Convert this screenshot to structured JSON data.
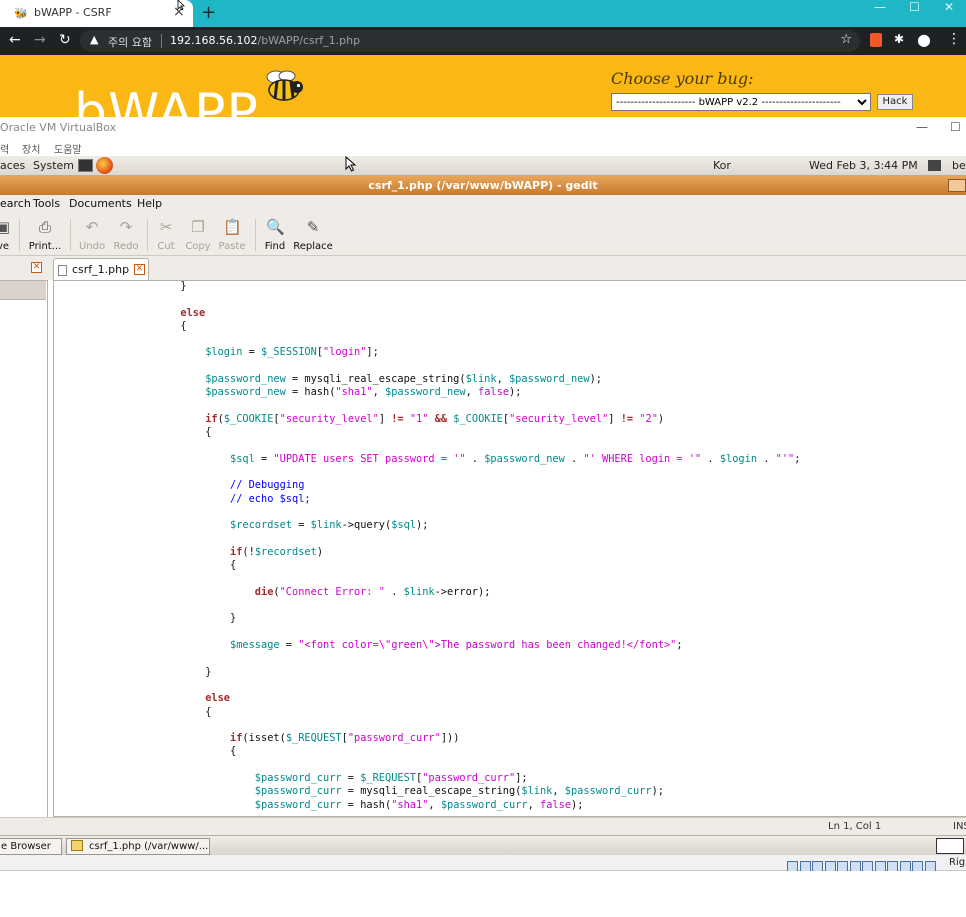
{
  "browser": {
    "tab_title": "bWAPP - CSRF",
    "tab_close": "×",
    "new_tab": "+",
    "warning_text": "주의 요함",
    "url_host": "192.168.56.102",
    "url_path": "/bWAPP/csrf_1.php"
  },
  "bwapp": {
    "logo_text": "bWAPP",
    "choose_label": "Choose your bug:",
    "selected_bug": "---------------------- bWAPP v2.2 ----------------------",
    "hack_label": "Hack"
  },
  "vbox": {
    "title": "Oracle VM VirtualBox",
    "menu": [
      "력",
      "장치",
      "도움말"
    ]
  },
  "gnome_panel": {
    "places": "aces",
    "system": "System",
    "keyboard": "Kor",
    "datetime": "Wed Feb  3,  3:44 PM",
    "user": "bee"
  },
  "gedit": {
    "title": "csrf_1.php (/var/www/bWAPP) - gedit",
    "menu": [
      "earch",
      "Tools",
      "Documents",
      "Help"
    ],
    "toolbar": {
      "save": "ve",
      "print": "Print...",
      "undo": "Undo",
      "redo": "Redo",
      "cut": "Cut",
      "copy": "Copy",
      "paste": "Paste",
      "find": "Find",
      "replace": "Replace"
    },
    "doc_tab": "csrf_1.php",
    "status_position": "Ln 1, Col 1",
    "status_mode": "INS"
  },
  "taskbar": {
    "item1": "e Browser",
    "item2": "csrf_1.php (/var/www/..."
  },
  "vbox_status": {
    "host_key": "Righ"
  },
  "code_lines": [
    [
      [
        "op",
        "            }"
      ]
    ],
    [
      [
        "op",
        ""
      ]
    ],
    [
      [
        "op",
        "            "
      ],
      [
        "kw",
        "else"
      ]
    ],
    [
      [
        "op",
        "            {"
      ]
    ],
    [
      [
        "op",
        ""
      ]
    ],
    [
      [
        "op",
        "                "
      ],
      [
        "vr",
        "$login"
      ],
      [
        "op",
        " = "
      ],
      [
        "vr",
        "$_SESSION"
      ],
      [
        "op",
        "["
      ],
      [
        "st",
        "\"login\""
      ],
      [
        "op",
        "];"
      ]
    ],
    [
      [
        "op",
        ""
      ]
    ],
    [
      [
        "op",
        "                "
      ],
      [
        "vr",
        "$password_new"
      ],
      [
        "op",
        " = mysqli_real_escape_string("
      ],
      [
        "vr",
        "$link"
      ],
      [
        "op",
        ", "
      ],
      [
        "vr",
        "$password_new"
      ],
      [
        "op",
        ");"
      ]
    ],
    [
      [
        "op",
        "                "
      ],
      [
        "vr",
        "$password_new"
      ],
      [
        "op",
        " = hash("
      ],
      [
        "st",
        "\"sha1\""
      ],
      [
        "op",
        ", "
      ],
      [
        "vr",
        "$password_new"
      ],
      [
        "op",
        ", "
      ],
      [
        "st",
        "false"
      ],
      [
        "op",
        ");"
      ]
    ],
    [
      [
        "op",
        ""
      ]
    ],
    [
      [
        "op",
        "                "
      ],
      [
        "kw",
        "if"
      ],
      [
        "op",
        "("
      ],
      [
        "vr",
        "$_COOKIE"
      ],
      [
        "op",
        "["
      ],
      [
        "st",
        "\"security_level\""
      ],
      [
        "op",
        "] "
      ],
      [
        "kw",
        "!="
      ],
      [
        "op",
        " "
      ],
      [
        "st",
        "\"1\""
      ],
      [
        "op",
        " "
      ],
      [
        "kw",
        "&&"
      ],
      [
        "op",
        " "
      ],
      [
        "vr",
        "$_COOKIE"
      ],
      [
        "op",
        "["
      ],
      [
        "st",
        "\"security_level\""
      ],
      [
        "op",
        "] "
      ],
      [
        "kw",
        "!="
      ],
      [
        "op",
        " "
      ],
      [
        "st",
        "\"2\""
      ],
      [
        "op",
        ")"
      ]
    ],
    [
      [
        "op",
        "                {"
      ]
    ],
    [
      [
        "op",
        ""
      ]
    ],
    [
      [
        "op",
        "                    "
      ],
      [
        "vr",
        "$sql"
      ],
      [
        "op",
        " = "
      ],
      [
        "st",
        "\"UPDATE users SET password = '\""
      ],
      [
        "op",
        " . "
      ],
      [
        "vr",
        "$password_new"
      ],
      [
        "op",
        " . "
      ],
      [
        "st",
        "\"' WHERE login = '\""
      ],
      [
        "op",
        " . "
      ],
      [
        "vr",
        "$login"
      ],
      [
        "op",
        " . "
      ],
      [
        "st",
        "\"'\""
      ],
      [
        "op",
        ";"
      ]
    ],
    [
      [
        "op",
        ""
      ]
    ],
    [
      [
        "op",
        "                    "
      ],
      [
        "cm",
        "// Debugging"
      ]
    ],
    [
      [
        "op",
        "                    "
      ],
      [
        "cm",
        "// echo $sql;"
      ]
    ],
    [
      [
        "op",
        ""
      ]
    ],
    [
      [
        "op",
        "                    "
      ],
      [
        "vr",
        "$recordset"
      ],
      [
        "op",
        " = "
      ],
      [
        "vr",
        "$link"
      ],
      [
        "op",
        "->query("
      ],
      [
        "vr",
        "$sql"
      ],
      [
        "op",
        ");"
      ]
    ],
    [
      [
        "op",
        ""
      ]
    ],
    [
      [
        "op",
        "                    "
      ],
      [
        "kw",
        "if"
      ],
      [
        "op",
        "(!"
      ],
      [
        "vr",
        "$recordset"
      ],
      [
        "op",
        ")"
      ]
    ],
    [
      [
        "op",
        "                    {"
      ]
    ],
    [
      [
        "op",
        ""
      ]
    ],
    [
      [
        "op",
        "                        "
      ],
      [
        "kw",
        "die"
      ],
      [
        "op",
        "("
      ],
      [
        "st",
        "\"Connect Error: \""
      ],
      [
        "op",
        " . "
      ],
      [
        "vr",
        "$link"
      ],
      [
        "op",
        "->error);"
      ]
    ],
    [
      [
        "op",
        ""
      ]
    ],
    [
      [
        "op",
        "                    }"
      ]
    ],
    [
      [
        "op",
        ""
      ]
    ],
    [
      [
        "op",
        "                    "
      ],
      [
        "vr",
        "$message"
      ],
      [
        "op",
        " = "
      ],
      [
        "st",
        "\"<font color=\\\"green\\\">The password has been changed!</font>\""
      ],
      [
        "op",
        ";"
      ]
    ],
    [
      [
        "op",
        ""
      ]
    ],
    [
      [
        "op",
        "                }"
      ]
    ],
    [
      [
        "op",
        ""
      ]
    ],
    [
      [
        "op",
        "                "
      ],
      [
        "kw",
        "else"
      ]
    ],
    [
      [
        "op",
        "                {"
      ]
    ],
    [
      [
        "op",
        ""
      ]
    ],
    [
      [
        "op",
        "                    "
      ],
      [
        "kw",
        "if"
      ],
      [
        "op",
        "(isset("
      ],
      [
        "vr",
        "$_REQUEST"
      ],
      [
        "op",
        "["
      ],
      [
        "st",
        "\"password_curr\""
      ],
      [
        "op",
        "]))"
      ]
    ],
    [
      [
        "op",
        "                    {"
      ]
    ],
    [
      [
        "op",
        ""
      ]
    ],
    [
      [
        "op",
        "                        "
      ],
      [
        "vr",
        "$password_curr"
      ],
      [
        "op",
        " = "
      ],
      [
        "vr",
        "$_REQUEST"
      ],
      [
        "op",
        "["
      ],
      [
        "st",
        "\"password_curr\""
      ],
      [
        "op",
        "];"
      ]
    ],
    [
      [
        "op",
        "                        "
      ],
      [
        "vr",
        "$password_curr"
      ],
      [
        "op",
        " = mysqli_real_escape_string("
      ],
      [
        "vr",
        "$link"
      ],
      [
        "op",
        ", "
      ],
      [
        "vr",
        "$password_curr"
      ],
      [
        "op",
        ");"
      ]
    ],
    [
      [
        "op",
        "                        "
      ],
      [
        "vr",
        "$password_curr"
      ],
      [
        "op",
        " = hash("
      ],
      [
        "st",
        "\"sha1\""
      ],
      [
        "op",
        ", "
      ],
      [
        "vr",
        "$password_curr"
      ],
      [
        "op",
        ", "
      ],
      [
        "st",
        "false"
      ],
      [
        "op",
        ");"
      ]
    ]
  ]
}
